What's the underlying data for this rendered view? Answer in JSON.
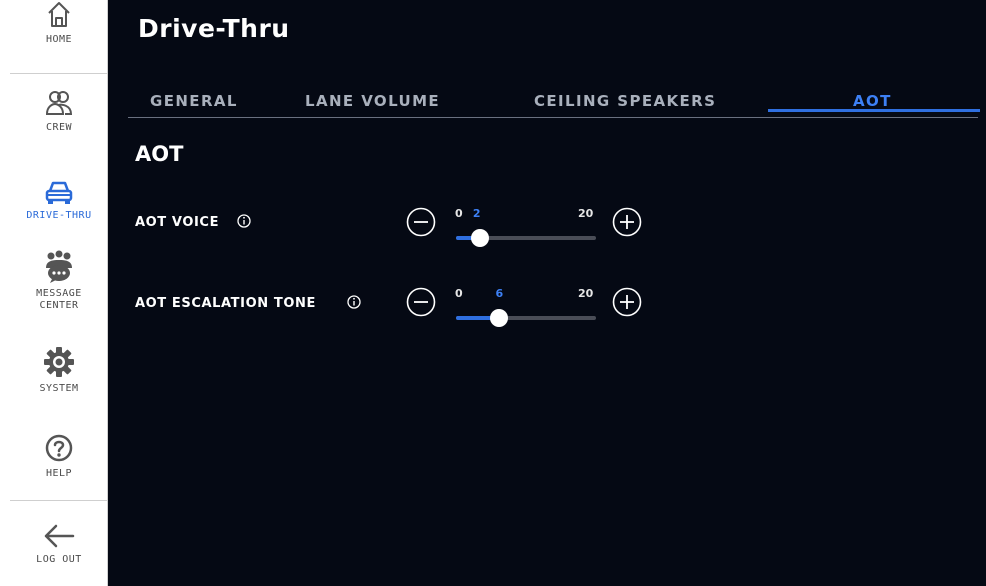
{
  "sidebar": {
    "items": [
      {
        "label": "HOME",
        "icon": "home-icon"
      },
      {
        "label": "CREW",
        "icon": "crew-icon"
      },
      {
        "label": "DRIVE-THRU",
        "icon": "car-icon",
        "active": true
      },
      {
        "label": "MESSAGE\nCENTER",
        "icon": "message-center-icon"
      },
      {
        "label": "SYSTEM",
        "icon": "gear-icon"
      },
      {
        "label": "HELP",
        "icon": "help-icon"
      },
      {
        "label": "LOG OUT",
        "icon": "arrow-left-icon"
      }
    ]
  },
  "header": {
    "title": "Drive-Thru"
  },
  "tabs": [
    {
      "label": "GENERAL"
    },
    {
      "label": "LANE VOLUME"
    },
    {
      "label": "CEILING SPEAKERS"
    },
    {
      "label": "AOT",
      "active": true
    }
  ],
  "section": {
    "title": "AOT"
  },
  "settings": [
    {
      "label": "AOT VOICE",
      "min": "0",
      "max": "20",
      "value": "2",
      "value_num": 2,
      "range": [
        0,
        20
      ]
    },
    {
      "label": "AOT ESCALATION TONE",
      "min": "0",
      "max": "20",
      "value": "6",
      "value_num": 6,
      "range": [
        0,
        20
      ]
    }
  ],
  "colors": {
    "accent": "#2f6fe0",
    "panel_bg": "#050914",
    "sidebar_bg": "#ffffff",
    "tab_inactive": "#a9b0bc",
    "track": "#4a4d57"
  }
}
